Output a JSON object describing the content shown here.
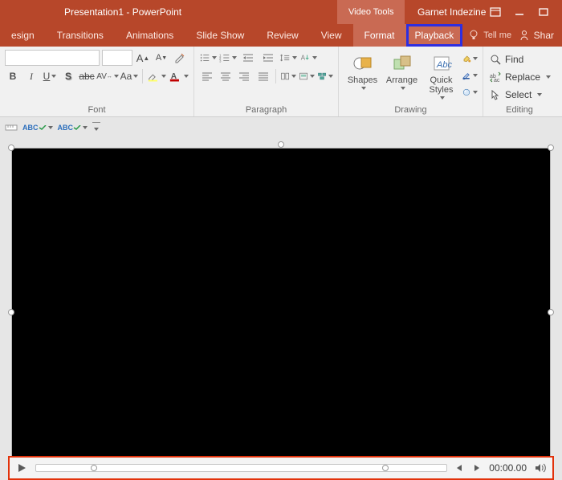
{
  "title": "Presentation1 - PowerPoint",
  "context_tool": "Video Tools",
  "user_name": "Garnet Indezine",
  "tabs": {
    "design": "esign",
    "transitions": "Transitions",
    "animations": "Animations",
    "slideshow": "Slide Show",
    "review": "Review",
    "view": "View",
    "format": "Format",
    "playback": "Playback"
  },
  "tellme": "Tell me",
  "share": "Shar",
  "groups": {
    "font": "Font",
    "paragraph": "Paragraph",
    "drawing": "Drawing",
    "editing": "Editing"
  },
  "font": {
    "name": "",
    "size": "",
    "bold": "B",
    "italic": "I",
    "underline": "U",
    "shadow": "S",
    "strike": "abc",
    "spacing": "AV",
    "case": "Aa"
  },
  "drawing": {
    "shapes": "Shapes",
    "arrange": "Arrange",
    "quick_styles": "Quick\nStyles"
  },
  "editing": {
    "find": "Find",
    "replace": "Replace",
    "select": "Select"
  },
  "qat": {
    "abc1": "ABC",
    "abc2": "ABC"
  },
  "media": {
    "time": "00:00.00"
  }
}
